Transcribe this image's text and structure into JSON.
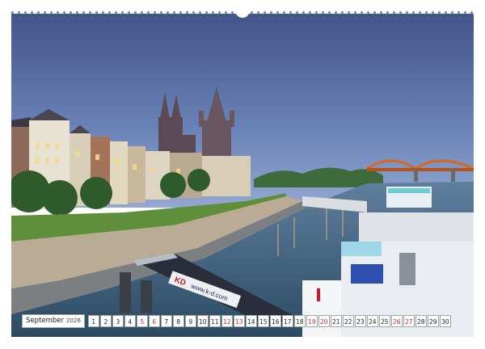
{
  "calendar": {
    "month": "September",
    "year": "2026",
    "days": [
      "1",
      "2",
      "3",
      "4",
      "5",
      "6",
      "7",
      "8",
      "9",
      "10",
      "11",
      "12",
      "13",
      "14",
      "15",
      "16",
      "17",
      "18",
      "19",
      "20",
      "21",
      "22",
      "23",
      "24",
      "25",
      "26",
      "27",
      "28",
      "29",
      "30"
    ],
    "weekend_days": [
      "5",
      "6",
      "12",
      "13",
      "19",
      "20",
      "26",
      "27"
    ]
  },
  "signage": {
    "ship_brand": "KD",
    "ship_url": "www.k-d.com"
  },
  "colors": {
    "sky_top": "#4a5a8c",
    "sky_bottom": "#7e95c4",
    "river": "#3b5b76",
    "weekend_red": "#d4242c",
    "bridge": "#d9671e"
  }
}
